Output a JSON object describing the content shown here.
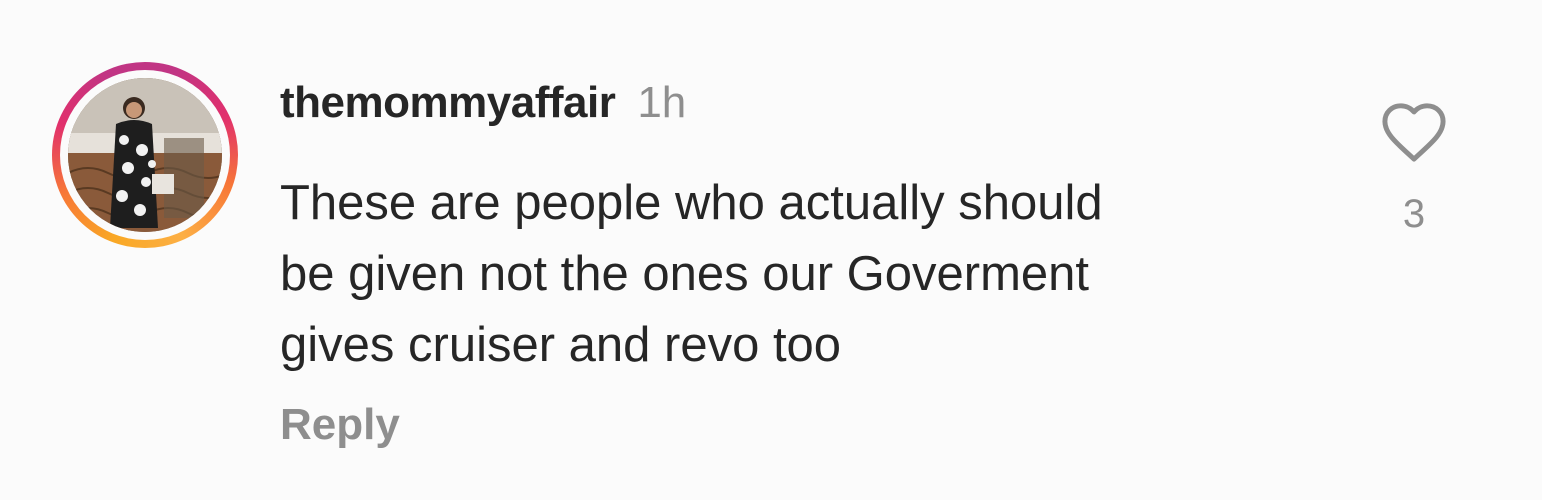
{
  "comment": {
    "username": "themommyaffair",
    "time": "1h",
    "text_lines": [
      "These are people who actually should",
      "be given not the ones our Goverment",
      "gives cruiser and revo too"
    ],
    "reply_label": "Reply",
    "like_count": "3"
  },
  "colors": {
    "text": "#262626",
    "secondary": "#8e8e8e",
    "background": "#fbfbfb"
  },
  "icons": {
    "like": "heart-outline-icon"
  }
}
